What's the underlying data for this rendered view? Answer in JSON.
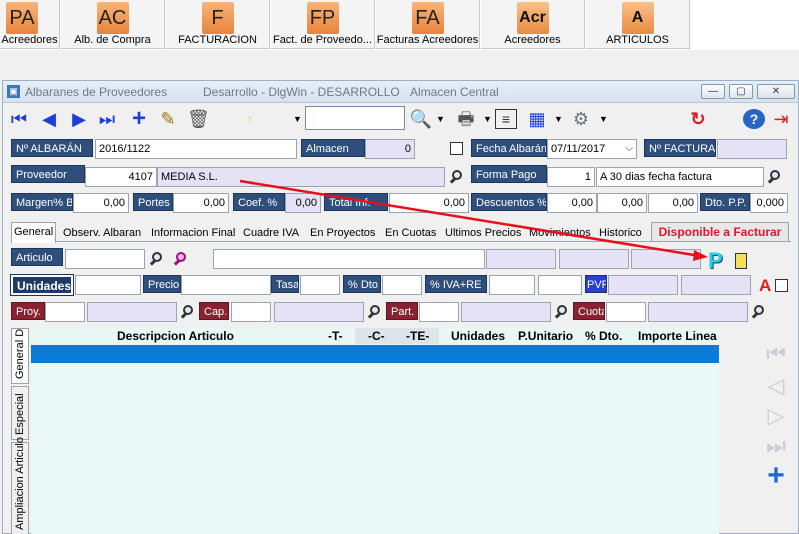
{
  "launcher": [
    {
      "icon": "PA",
      "label": "Acreedores"
    },
    {
      "icon": "AC",
      "label": "Alb. de Compra"
    },
    {
      "icon": "F",
      "label": "FACTURACION"
    },
    {
      "icon": "FP",
      "label": "Fact. de Proveedo..."
    },
    {
      "icon": "FA",
      "label": "Facturas Acreedores"
    },
    {
      "icon": "Acr",
      "label": "Acreedores"
    },
    {
      "icon": "A",
      "label": "ARTICULOS"
    }
  ],
  "window": {
    "title": "Albaranes de Proveedores",
    "subtitle": "Desarrollo - DlgWin - DESARROLLO",
    "location": "Almacen Central"
  },
  "header": {
    "albaran_label": "Nº ALBARÁN",
    "albaran_value": "2016/1122",
    "almacen_label": "Almacen",
    "almacen_value": "0",
    "fecha_label": "Fecha Albarán",
    "fecha_value": "07/11/2017",
    "factura_label": "Nº FACTURA",
    "factura_value": "",
    "proveedor_label": "Proveedor",
    "proveedor_code": "4107",
    "proveedor_name": "MEDIA S.L.",
    "forma_pago_label": "Forma Pago",
    "forma_pago_code": "1",
    "forma_pago_desc": "A 30 dias fecha factura",
    "margen_label": "Margen% B",
    "margen_value": "0,00",
    "portes_label": "Portes",
    "portes_value": "0,00",
    "coef_label": "Coef. %",
    "coef_value": "0,00",
    "total_label": "Total Inf.",
    "total_value": "0,00",
    "descuentos_label": "Descuentos %",
    "desc1": "0,00",
    "desc2": "0,00",
    "desc3": "0,00",
    "dto_pp_label": "Dto. P.P.",
    "dto_pp_value": "0,000"
  },
  "tabs": [
    "General",
    "Observ. Albaran",
    "Informacion Final",
    "Cuadre IVA",
    "En Proyectos",
    "En Cuotas",
    "Ultimos Precios",
    "Movimientos",
    "Historico"
  ],
  "status_banner": "Disponible a Facturar",
  "line_form": {
    "articulo_label": "Articulo",
    "unidades_label": "Unidades",
    "precio_label": "Precio",
    "tasa_label": "Tasa",
    "dto_label": "% Dto",
    "iva_label": "% IVA+RE",
    "pvp_label": "PVP",
    "proy_label": "Proy.",
    "cap_label": "Cap.",
    "part_label": "Part.",
    "cuota_label": "Cuota",
    "a_badge": "A",
    "p_badge": "P"
  },
  "grid": {
    "columns": [
      "Descripcion Articulo",
      "-T-",
      "-C-",
      "-TE-",
      "Unidades",
      "P.Unitario",
      "% Dto.",
      "Importe Linea"
    ]
  },
  "side_tabs": [
    "General D",
    "Especial",
    "Ampliacion Articulo"
  ],
  "colors": {
    "annotation_arrow": "#e8101c",
    "selected_row": "#0a7bd6",
    "label_bg": "#2e4f7c"
  }
}
